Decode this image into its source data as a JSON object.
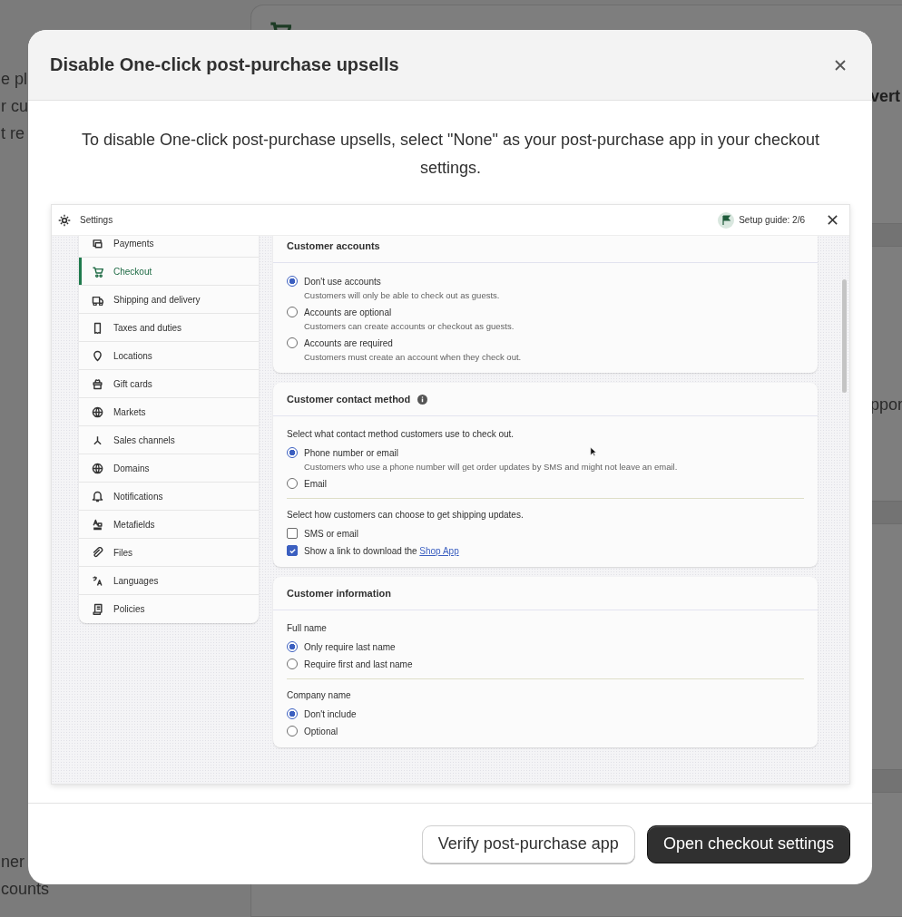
{
  "background_page": {
    "left_top_fragments": [
      "e pl",
      "r cu",
      "t re"
    ],
    "left_bottom_fragments": [
      "ner",
      "counts"
    ],
    "right_heading_fragment": "vert",
    "right_text_fragment": "ppor"
  },
  "modal": {
    "title": "Disable One-click post-purchase upsells",
    "description": "To disable One-click post-purchase upsells, select \"None\" as your post-purchase app in your checkout settings.",
    "screenshot": {
      "title": "Settings",
      "setup_guide": "Setup guide: 2/6",
      "nav": [
        {
          "label": "Payments",
          "selected": false
        },
        {
          "label": "Checkout",
          "selected": true
        },
        {
          "label": "Shipping and delivery",
          "selected": false
        },
        {
          "label": "Taxes and duties",
          "selected": false
        },
        {
          "label": "Locations",
          "selected": false
        },
        {
          "label": "Gift cards",
          "selected": false
        },
        {
          "label": "Markets",
          "selected": false
        },
        {
          "label": "Sales channels",
          "selected": false
        },
        {
          "label": "Domains",
          "selected": false
        },
        {
          "label": "Notifications",
          "selected": false
        },
        {
          "label": "Metafields",
          "selected": false
        },
        {
          "label": "Files",
          "selected": false
        },
        {
          "label": "Languages",
          "selected": false
        },
        {
          "label": "Policies",
          "selected": false
        }
      ],
      "sections": [
        {
          "title": "Customer accounts",
          "info": false,
          "groups": [
            {
              "options": [
                {
                  "kind": "radio",
                  "label": "Don't use accounts",
                  "hint": "Customers will only be able to check out as guests.",
                  "selected": true
                },
                {
                  "kind": "radio",
                  "label": "Accounts are optional",
                  "hint": "Customers can create accounts or checkout as guests.",
                  "selected": false
                },
                {
                  "kind": "radio",
                  "label": "Accounts are required",
                  "hint": "Customers must create an account when they check out.",
                  "selected": false
                }
              ]
            }
          ]
        },
        {
          "title": "Customer contact method",
          "info": true,
          "groups": [
            {
              "label": "Select what contact method customers use to check out.",
              "options": [
                {
                  "kind": "radio",
                  "label": "Phone number or email",
                  "hint": "Customers who use a phone number will get order updates by SMS and might not leave an email.",
                  "selected": true
                },
                {
                  "kind": "radio",
                  "label": "Email",
                  "selected": false
                }
              ]
            },
            {
              "label": "Select how customers can choose to get shipping updates.",
              "options": [
                {
                  "kind": "checkbox",
                  "label": "SMS or email",
                  "checked": false
                },
                {
                  "kind": "checkbox",
                  "label": "Show a link to download the",
                  "link": "Shop App",
                  "checked": true
                }
              ]
            }
          ]
        },
        {
          "title": "Customer information",
          "info": false,
          "groups": [
            {
              "label": "Full name",
              "options": [
                {
                  "kind": "radio",
                  "label": "Only require last name",
                  "selected": true
                },
                {
                  "kind": "radio",
                  "label": "Require first and last name",
                  "selected": false
                }
              ]
            },
            {
              "label": "Company name",
              "options": [
                {
                  "kind": "radio",
                  "label": "Don't include",
                  "selected": true
                },
                {
                  "kind": "radio",
                  "label": "Optional",
                  "selected": false
                }
              ]
            }
          ]
        }
      ]
    },
    "buttons": [
      {
        "label": "Verify post-purchase app",
        "kind": "secondary"
      },
      {
        "label": "Open checkout settings",
        "kind": "primary"
      }
    ]
  }
}
